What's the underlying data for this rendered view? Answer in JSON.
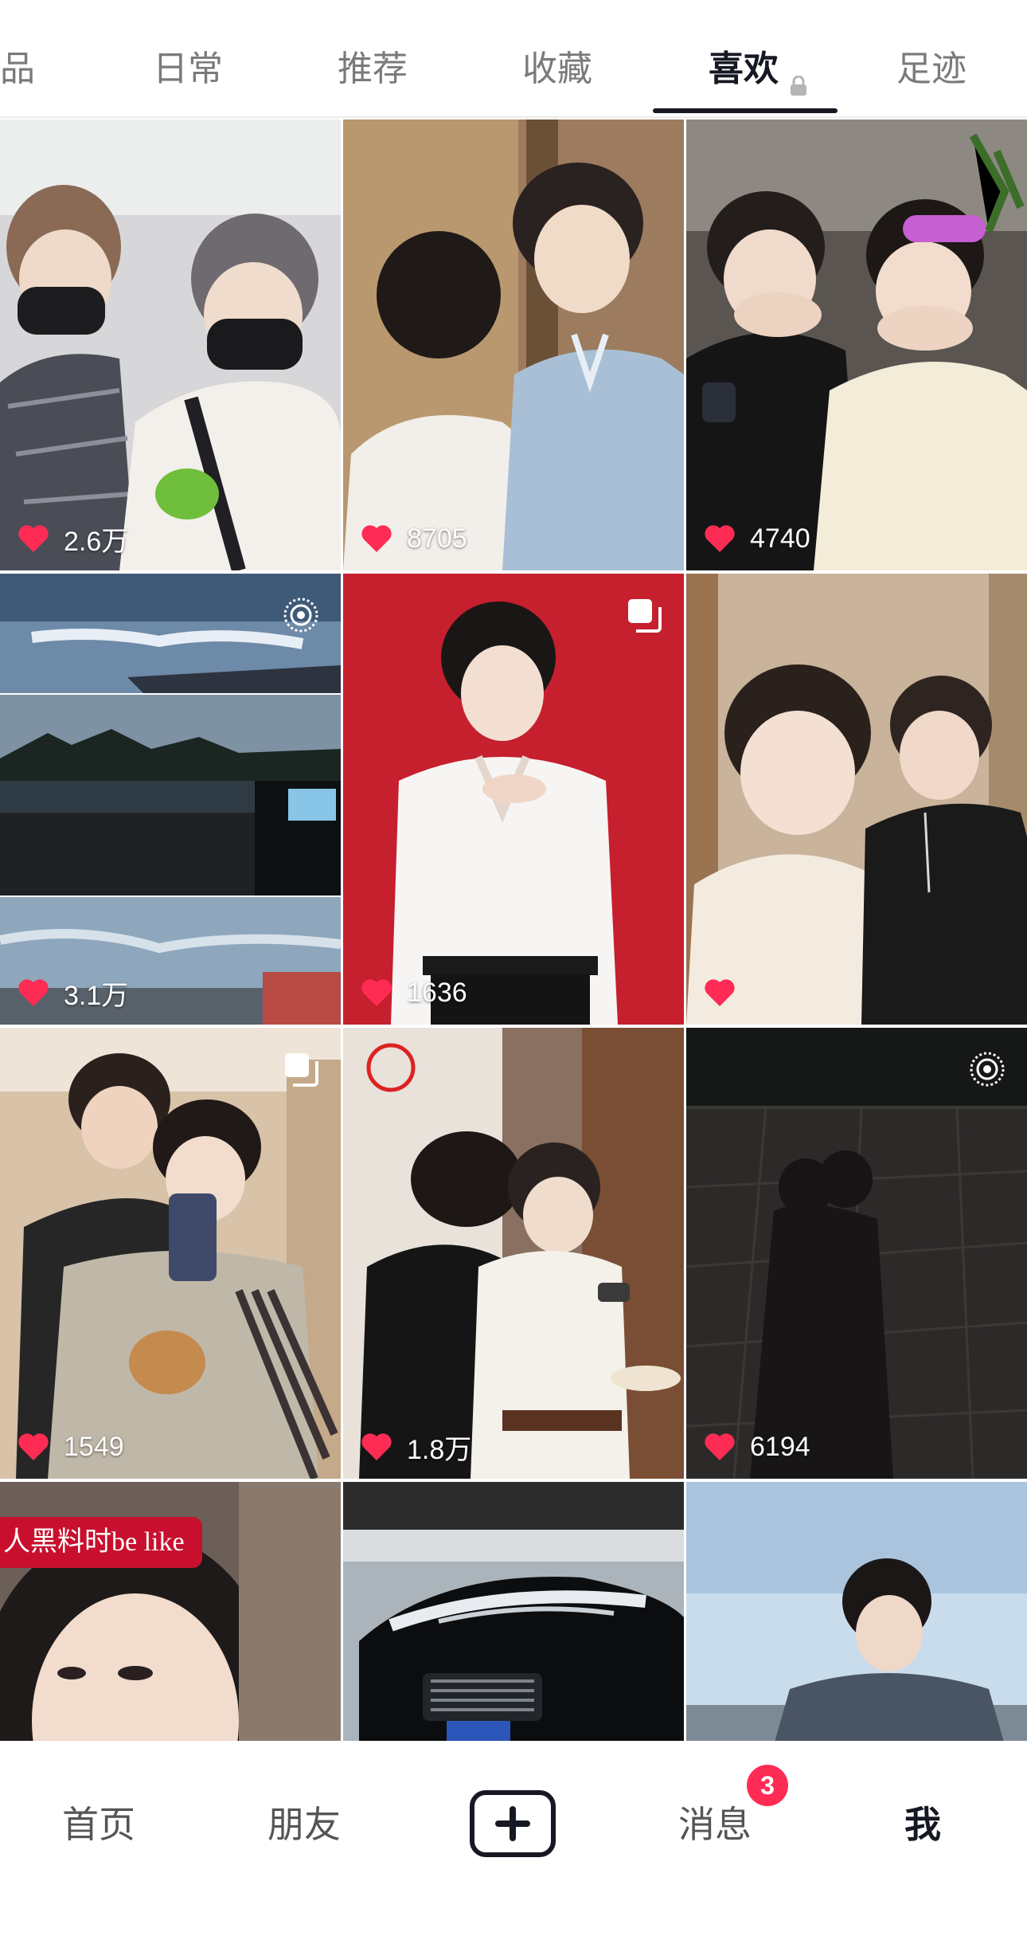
{
  "tabs": [
    {
      "label": "品"
    },
    {
      "label": "日常"
    },
    {
      "label": "推荐"
    },
    {
      "label": "收藏"
    },
    {
      "label": "喜欢",
      "locked": true,
      "active": true
    },
    {
      "label": "足迹"
    }
  ],
  "grid": {
    "items": [
      {
        "likes": "2.6万",
        "corner_icon": ""
      },
      {
        "likes": "8705",
        "corner_icon": ""
      },
      {
        "likes": "4740",
        "corner_icon": ""
      },
      {
        "likes": "3.1万",
        "corner_icon": "live-photo-icon"
      },
      {
        "likes": "1636",
        "corner_icon": "multi-image-icon"
      },
      {
        "likes": "",
        "corner_icon": ""
      },
      {
        "likes": "1549",
        "corner_icon": "multi-image-icon"
      },
      {
        "likes": "1.8万",
        "corner_icon": ""
      },
      {
        "likes": "6194",
        "corner_icon": "live-photo-icon"
      },
      {
        "likes": "",
        "caption": "人黑料时be like"
      },
      {
        "likes": ""
      },
      {
        "likes": ""
      }
    ]
  },
  "bottom_nav": {
    "home": "首页",
    "friends": "朋友",
    "messages": "消息",
    "messages_badge": "3",
    "me": "我"
  },
  "colors": {
    "accent": "#fe2c55",
    "text_active": "#161823",
    "text_inactive": "#7a7a7a"
  }
}
